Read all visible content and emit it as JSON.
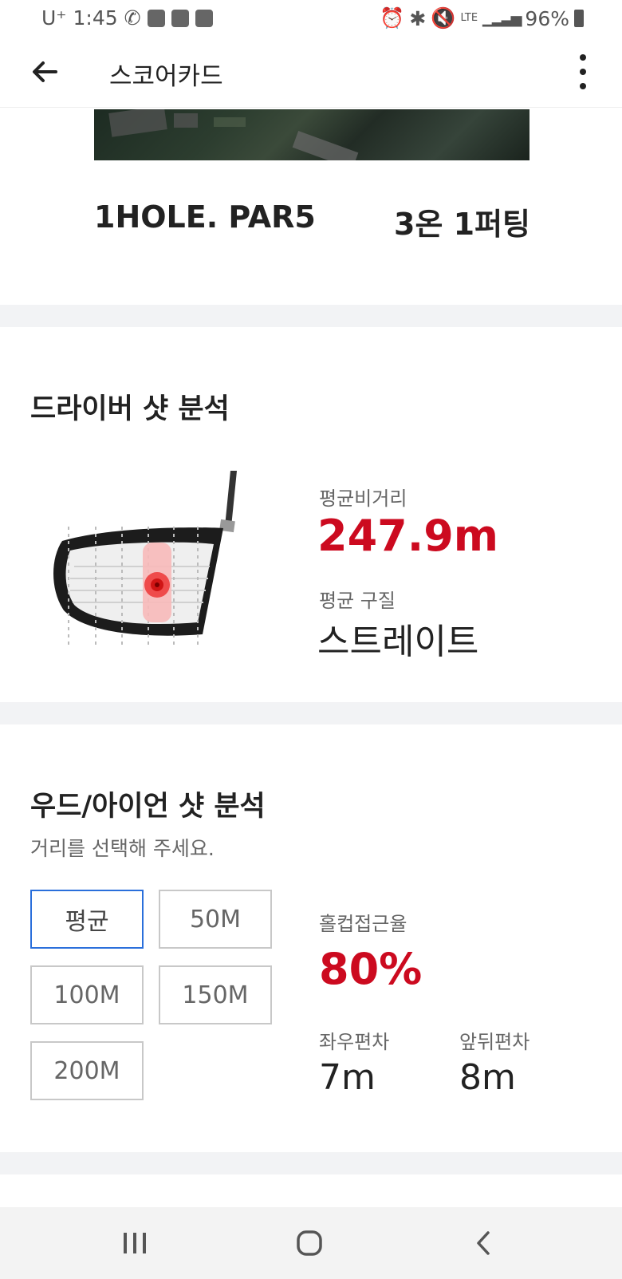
{
  "status_bar": {
    "carrier": "U⁺",
    "time": "1:45",
    "battery": "96%",
    "network": "LTE"
  },
  "app_bar": {
    "title": "스코어카드"
  },
  "hole": {
    "name": "1HOLE. PAR5",
    "result": "3온 1퍼팅"
  },
  "driver": {
    "title": "드라이버 샷 분석",
    "avg_distance_label": "평균비거리",
    "avg_distance_value": "247.9m",
    "avg_quality_label": "평균 구질",
    "avg_quality_value": "스트레이트"
  },
  "wood_iron": {
    "title": "우드/아이언 샷 분석",
    "subtitle": "거리를 선택해 주세요.",
    "buttons": [
      "평균",
      "50M",
      "100M",
      "150M",
      "200M"
    ],
    "selected": "평균",
    "cup_rate_label": "홀컵접근율",
    "cup_rate_value": "80%",
    "lr_dev_label": "좌우편차",
    "lr_dev_value": "7m",
    "fb_dev_label": "앞뒤편차",
    "fb_dev_value": "8m"
  },
  "colors": {
    "accent_red": "#cc0a1f",
    "selected_border": "#2a6fdb"
  },
  "icons": [
    "back-arrow-icon",
    "more-vert-icon",
    "recent-apps-icon",
    "home-icon",
    "nav-back-icon"
  ]
}
